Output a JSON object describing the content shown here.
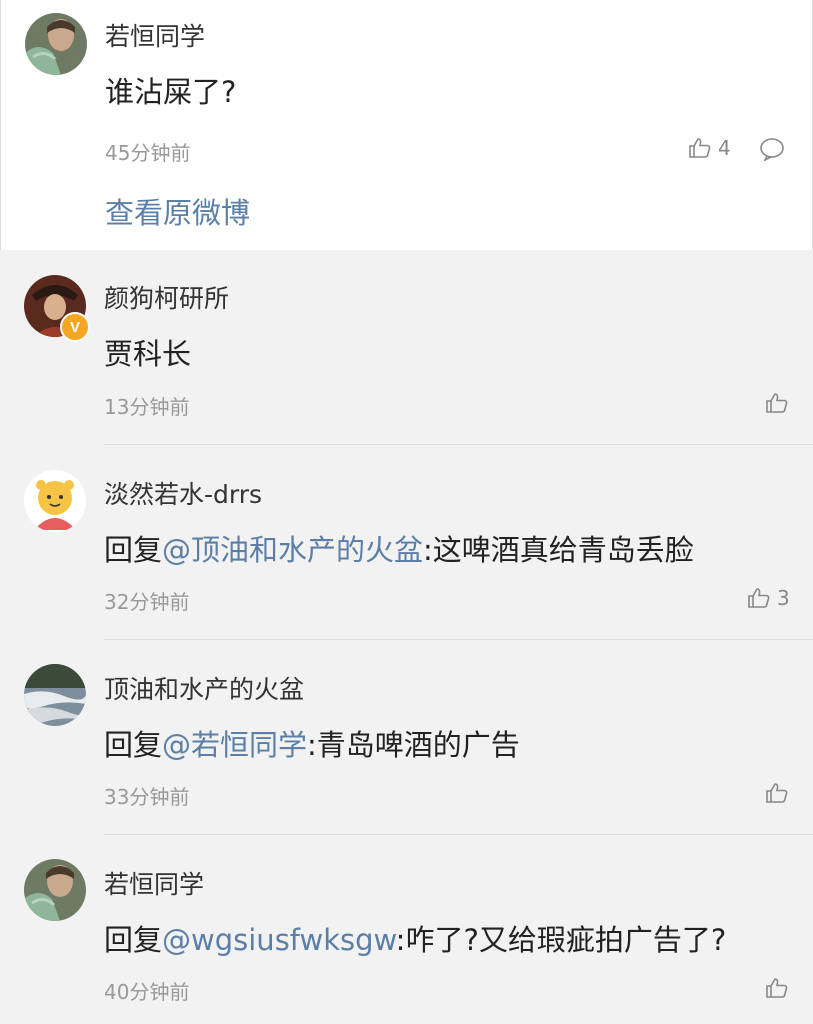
{
  "top_comment": {
    "author": "若恒同学",
    "text": "谁沾屎了?",
    "time": "45分钟前",
    "likes": "4",
    "view_original": "查看原微博"
  },
  "replies": [
    {
      "author": "颜狗柯研所",
      "text": "贾科长",
      "time": "13分钟前",
      "verified_badge": "V"
    },
    {
      "author": "淡然若水-drrs",
      "prefix": "回复",
      "mention": "@顶油和水产的火盆",
      "text": ":这啤酒真给青岛丢脸",
      "time": "32分钟前",
      "likes": "3"
    },
    {
      "author": "顶油和水产的火盆",
      "prefix": "回复",
      "mention": "@若恒同学",
      "text": ":青岛啤酒的广告",
      "time": "33分钟前"
    },
    {
      "author": "若恒同学",
      "prefix": "回复",
      "mention": "@wgsiusfwksgw",
      "text": ":咋了?又给瑕疵拍广告了?",
      "time": "40分钟前"
    }
  ],
  "colors": {
    "link": "#5b7fa6",
    "background": "#f2f2f2",
    "card": "#ffffff",
    "badge": "#f5a623"
  }
}
